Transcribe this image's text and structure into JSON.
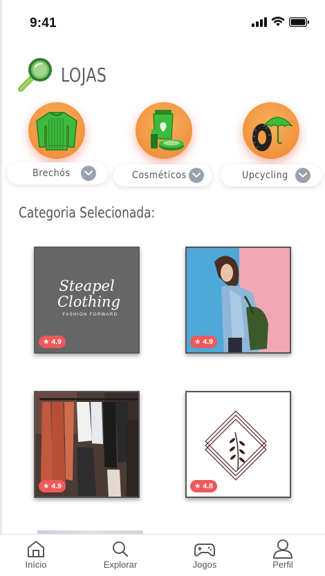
{
  "status": {
    "time": "9:41"
  },
  "header": {
    "title": "LOJAS",
    "icon": "magnifier-icon"
  },
  "categories": [
    {
      "label": "Brechós",
      "icon": "sweater-icon"
    },
    {
      "label": "Cosméticos",
      "icon": "cosmetics-icon"
    },
    {
      "label": "Upcycling",
      "icon": "tire-umbrella-icon"
    }
  ],
  "section_title": "Categoria Selecionada:",
  "stores": [
    {
      "logo_line1": "Steapel",
      "logo_line2": "Clothing",
      "logo_tag": "FASHION FORWARD",
      "rating": "4.9"
    },
    {
      "rating": "4.9"
    },
    {
      "rating": "4.9"
    },
    {
      "rating": "4.8"
    }
  ],
  "tabs": [
    {
      "label": "Início",
      "icon": "home-icon"
    },
    {
      "label": "Explorar",
      "icon": "search-icon"
    },
    {
      "label": "Jogos",
      "icon": "gamepad-icon"
    },
    {
      "label": "Perfil",
      "icon": "user-icon"
    }
  ],
  "colors": {
    "accent_orange": "#f39a45",
    "rating_red": "#ee5a5a",
    "chevron_gray": "#9aa0ad",
    "green": "#3dbb3d"
  }
}
